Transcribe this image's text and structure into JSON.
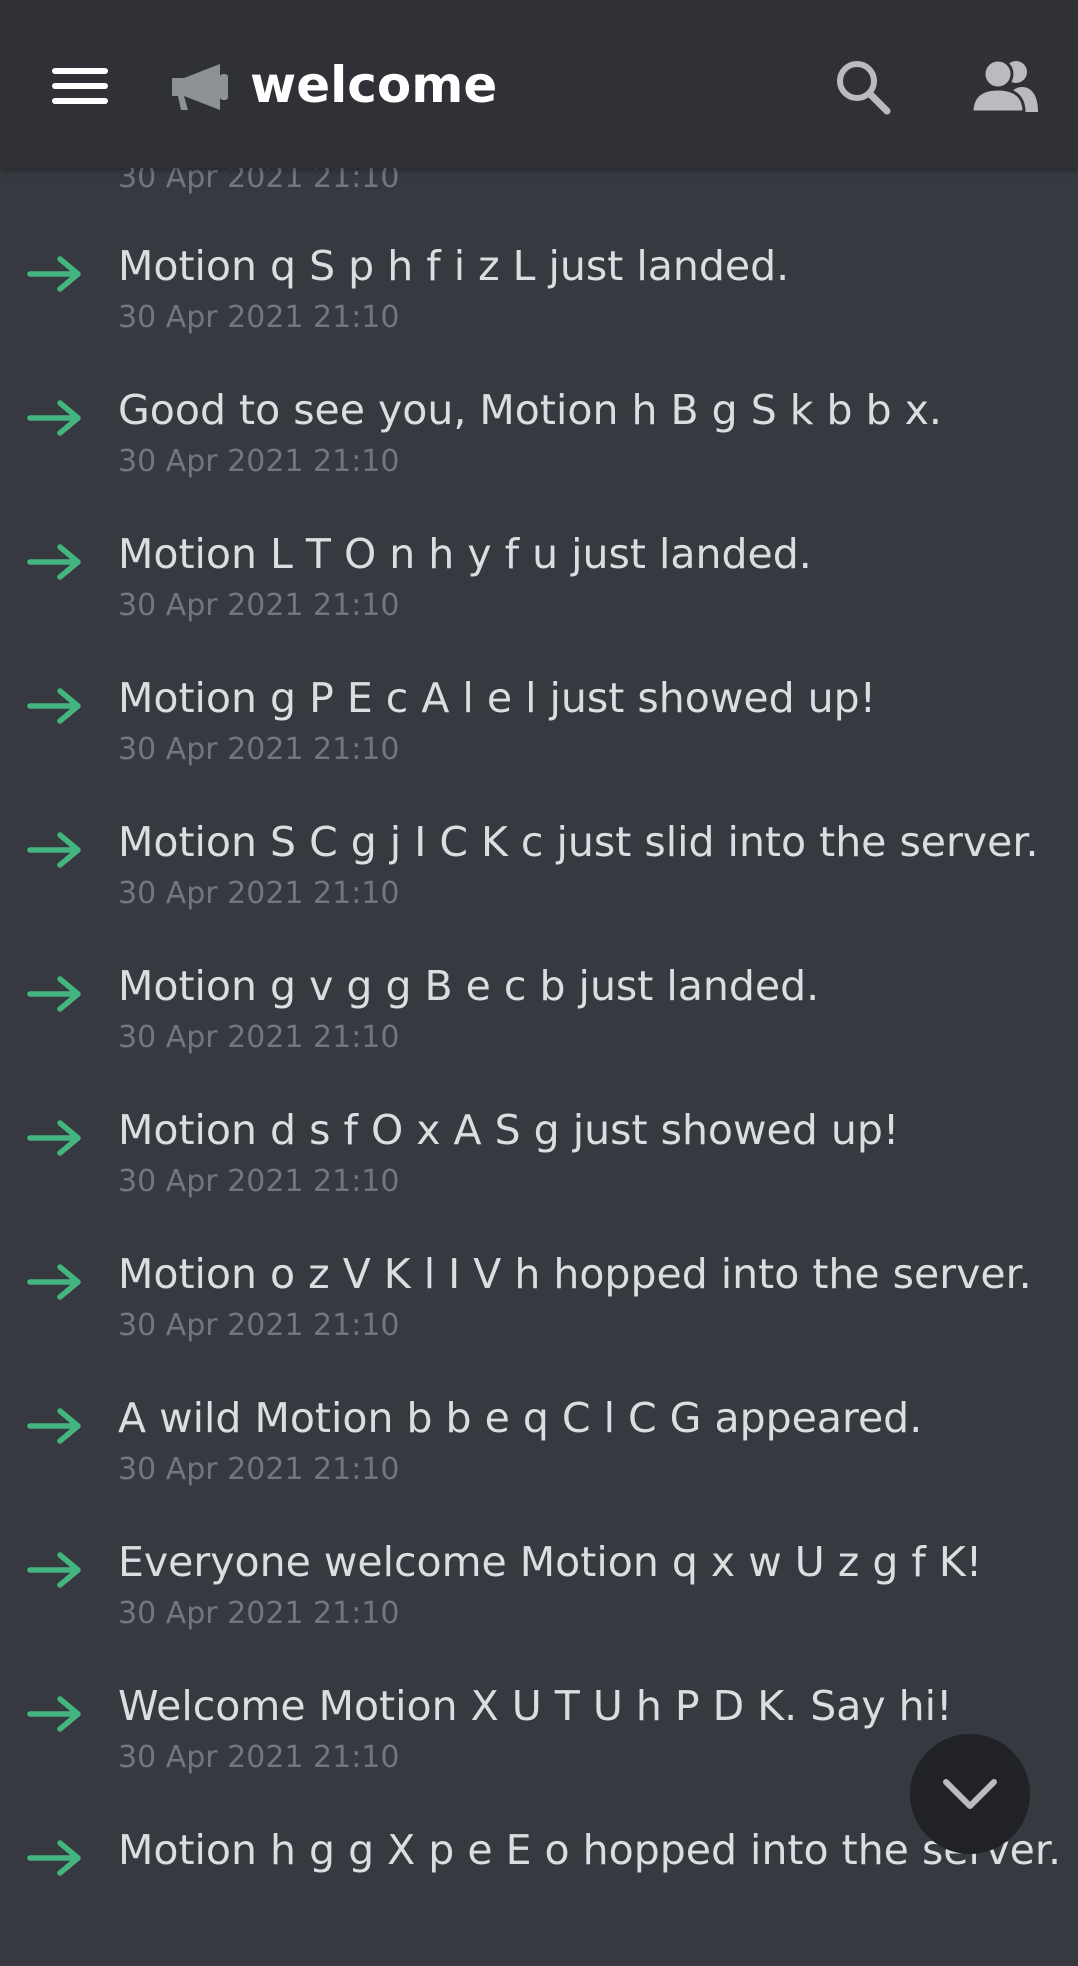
{
  "header": {
    "channel_name": "welcome"
  },
  "messages": [
    {
      "text": "Motion q S p h f i z L just landed.",
      "time": "30 Apr 2021 21:10"
    },
    {
      "text": "Good to see you, Motion h B g S k b b x.",
      "time": "30 Apr 2021 21:10"
    },
    {
      "text": "Motion L T O n h y f u just landed.",
      "time": "30 Apr 2021 21:10"
    },
    {
      "text": "Motion g P E c A l e l just showed up!",
      "time": "30 Apr 2021 21:10"
    },
    {
      "text": "Motion S C g j I C K c just slid into the server.",
      "time": "30 Apr 2021 21:10"
    },
    {
      "text": "Motion g v g g B e c b just landed.",
      "time": "30 Apr 2021 21:10"
    },
    {
      "text": "Motion d s f O x A S g just showed up!",
      "time": "30 Apr 2021 21:10"
    },
    {
      "text": "Motion o z V K l I V h hopped into the server.",
      "time": "30 Apr 2021 21:10"
    },
    {
      "text": "A wild Motion b b e q C l C G appeared.",
      "time": "30 Apr 2021 21:10"
    },
    {
      "text": "Everyone welcome Motion q x w U z g f K!",
      "time": "30 Apr 2021 21:10"
    },
    {
      "text": "Welcome Motion X U T U h P D K. Say hi!",
      "time": "30 Apr 2021 21:10"
    },
    {
      "text": "Motion h g g X p e E o hopped into the server.",
      "time": ""
    }
  ],
  "partial_time": "30 Apr 2021 21:10",
  "colors": {
    "background": "#36393f",
    "header": "#2f3136",
    "arrow": "#43b581",
    "timestamp": "#72767d"
  },
  "icons": [
    "menu-icon",
    "announcement-channel-icon",
    "search-icon",
    "members-icon",
    "join-arrow-icon",
    "chevron-down-icon"
  ]
}
